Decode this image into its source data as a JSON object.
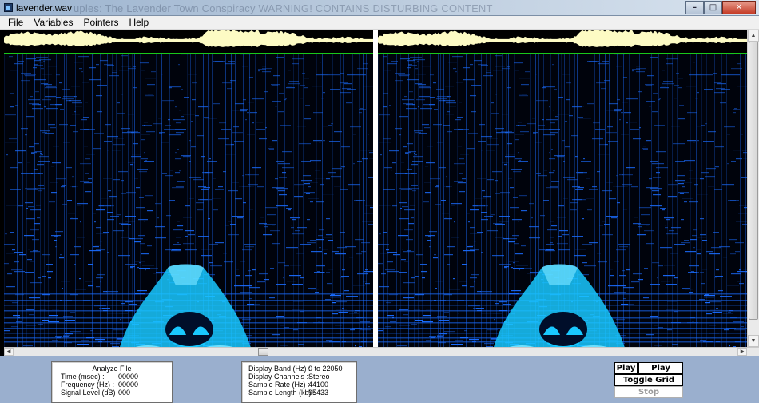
{
  "window": {
    "title": "lavender.wav",
    "background_title_ghost": "uples: The Lavender Town Conspiracy WARNING! CONTAINS DISTURBING CONTENT",
    "controls": [
      "minimize",
      "maximize",
      "close"
    ]
  },
  "menu": {
    "items": [
      "File",
      "Variables",
      "Pointers",
      "Help"
    ]
  },
  "spectrogram": {
    "panels": 2,
    "colors": {
      "background": "#00030c",
      "signal": "#1a6cff",
      "bright": "#19c8ff",
      "waveform": "#fdfbc4",
      "baseline": "#19c81a"
    }
  },
  "analyze": {
    "title": "Analyze File",
    "rows": [
      {
        "label": "Time (msec) :",
        "value": "00000"
      },
      {
        "label": "Frequency (Hz) :",
        "value": "00000"
      },
      {
        "label": "Signal Level (dB)",
        "value": "000"
      }
    ]
  },
  "display": {
    "rows": [
      {
        "label": "Display Band (Hz) :",
        "value": "0 to 22050"
      },
      {
        "label": "Display Channels :",
        "value": "Stereo"
      },
      {
        "label": "Sample Rate (Hz) :",
        "value": "44100"
      },
      {
        "label": "Sample Length (kb) :",
        "value": "95433"
      }
    ]
  },
  "buttons": {
    "play": "Play",
    "play_wdw": "Play Wdw",
    "toggle_grid": "Toggle Grid",
    "stop": "Stop"
  }
}
